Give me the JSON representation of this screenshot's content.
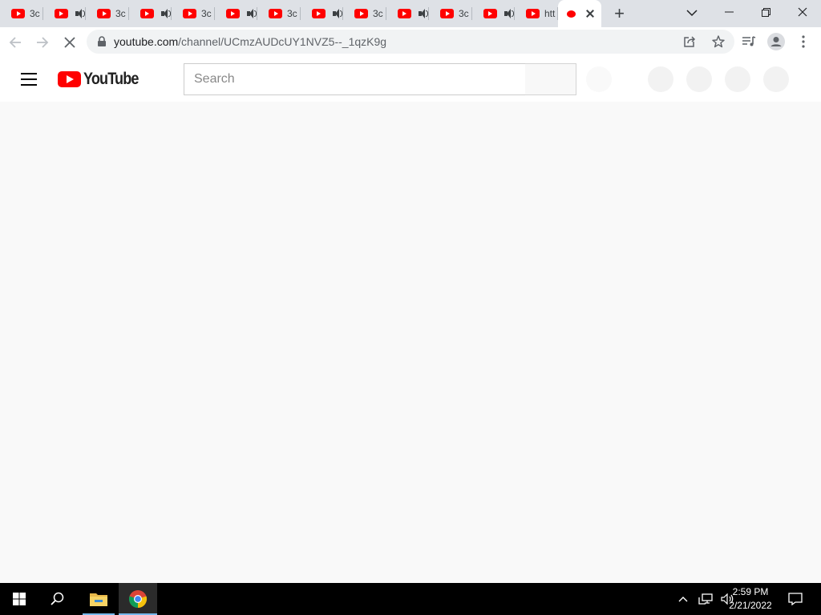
{
  "browser": {
    "tabs": [
      {
        "title": "3c",
        "kind": "text"
      },
      {
        "title": "",
        "kind": "audio"
      },
      {
        "title": "3c",
        "kind": "text"
      },
      {
        "title": "",
        "kind": "audio"
      },
      {
        "title": "3c",
        "kind": "text"
      },
      {
        "title": "",
        "kind": "audio"
      },
      {
        "title": "3c",
        "kind": "text"
      },
      {
        "title": "",
        "kind": "audio"
      },
      {
        "title": "3c",
        "kind": "text"
      },
      {
        "title": "",
        "kind": "audio"
      },
      {
        "title": "3c",
        "kind": "text"
      },
      {
        "title": "",
        "kind": "audio"
      },
      {
        "title": "htt",
        "kind": "text"
      }
    ],
    "active_tab": {
      "title": ""
    },
    "new_tab_label": "+",
    "url_host": "youtube.com",
    "url_path": "/channel/UCmzAUDcUY1NVZ5--_1qzK9g"
  },
  "youtube": {
    "logo_text": "YouTube",
    "search_placeholder": "Search"
  },
  "taskbar": {
    "time": "2:59 PM",
    "date": "2/21/2022"
  },
  "colors": {
    "youtube_red": "#ff0000",
    "tabstrip_bg": "#dee1e6",
    "page_bg": "#f9f9f9",
    "taskbar_bg": "#000000"
  }
}
